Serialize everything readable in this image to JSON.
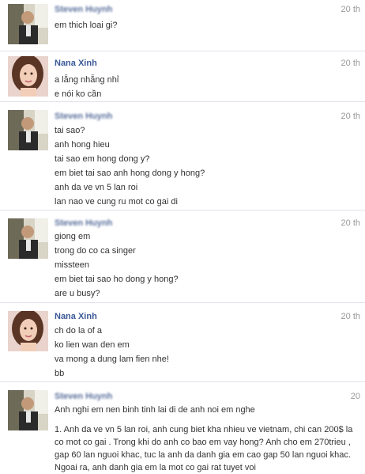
{
  "messages": [
    {
      "sender": "Steven Huynh",
      "time": "20 th",
      "lines": [
        "em thich loai gi?"
      ]
    },
    {
      "sender": "Nana Xinh",
      "time": "20 th",
      "lines": [
        "a lẵng nhẵng nhỉ",
        "e nói ko cần"
      ]
    },
    {
      "sender": "Steven Huynh",
      "time": "20 th",
      "lines": [
        "tai sao?",
        "anh hong hieu",
        "tai sao em hong dong y?",
        "em biet tai sao anh hong dong y hong?",
        "anh da ve vn 5 lan roi",
        "lan nao ve cung ru mot co gai di"
      ]
    },
    {
      "sender": "Steven Huynh",
      "time": "20 th",
      "lines": [
        "giong em",
        "trong do co ca singer",
        "missteen",
        "em biet tai sao ho dong y hong?",
        "are u busy?"
      ]
    },
    {
      "sender": "Nana Xinh",
      "time": "20 th",
      "lines": [
        "ch do la of a",
        "ko lien wan den em",
        "va mong a dung lam fien nhe!",
        "bb"
      ]
    },
    {
      "sender": "Steven Huynh",
      "time": "20",
      "lines": [
        "Anh nghi em nen binh tinh lai di de anh noi em nghe"
      ],
      "paragraph": "1. Anh da ve vn 5 lan roi, anh cung biet kha nhieu ve vietnam, chi can 200$ la co mot co gai . Trong khi do anh co bao em vay hong? Anh cho em 270trieu , gap 60 lan nguoi khac, tuc la anh da danh gia em cao gap 50 lan nguoi khac. Ngoai ra, anh danh gia em la mot co gai rat tuyet voi"
    }
  ]
}
